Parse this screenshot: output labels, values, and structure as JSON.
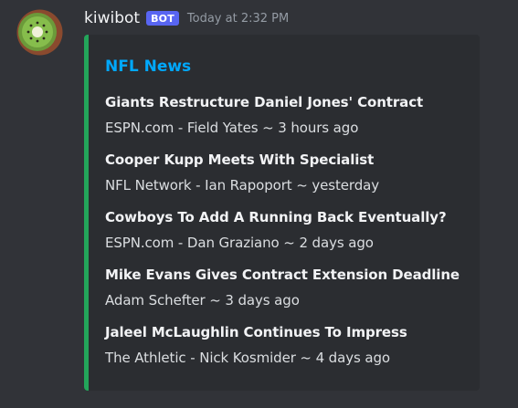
{
  "message": {
    "avatar_icon": "kiwi-icon",
    "username": "kiwibot",
    "bot_tag": "BOT",
    "timestamp": "Today at 2:32 PM"
  },
  "embed": {
    "accent_color": "#23a55a",
    "title": "NFL News",
    "title_color": "#00a8fc",
    "items": [
      {
        "headline": "Giants Restructure Daniel Jones' Contract",
        "meta": "ESPN.com - Field Yates ~ 3 hours ago"
      },
      {
        "headline": "Cooper Kupp Meets With Specialist",
        "meta": "NFL Network - Ian Rapoport ~ yesterday"
      },
      {
        "headline": "Cowboys To Add A Running Back Eventually?",
        "meta": "ESPN.com - Dan Graziano ~ 2 days ago"
      },
      {
        "headline": "Mike Evans Gives Contract Extension Deadline",
        "meta": "Adam Schefter ~ 3 days ago"
      },
      {
        "headline": "Jaleel McLaughlin Continues To Impress",
        "meta": "The Athletic - Nick Kosmider ~ 4 days ago"
      }
    ]
  },
  "colors": {
    "background": "#313338",
    "embed_background": "#2b2d31",
    "bot_tag": "#5865f2"
  }
}
